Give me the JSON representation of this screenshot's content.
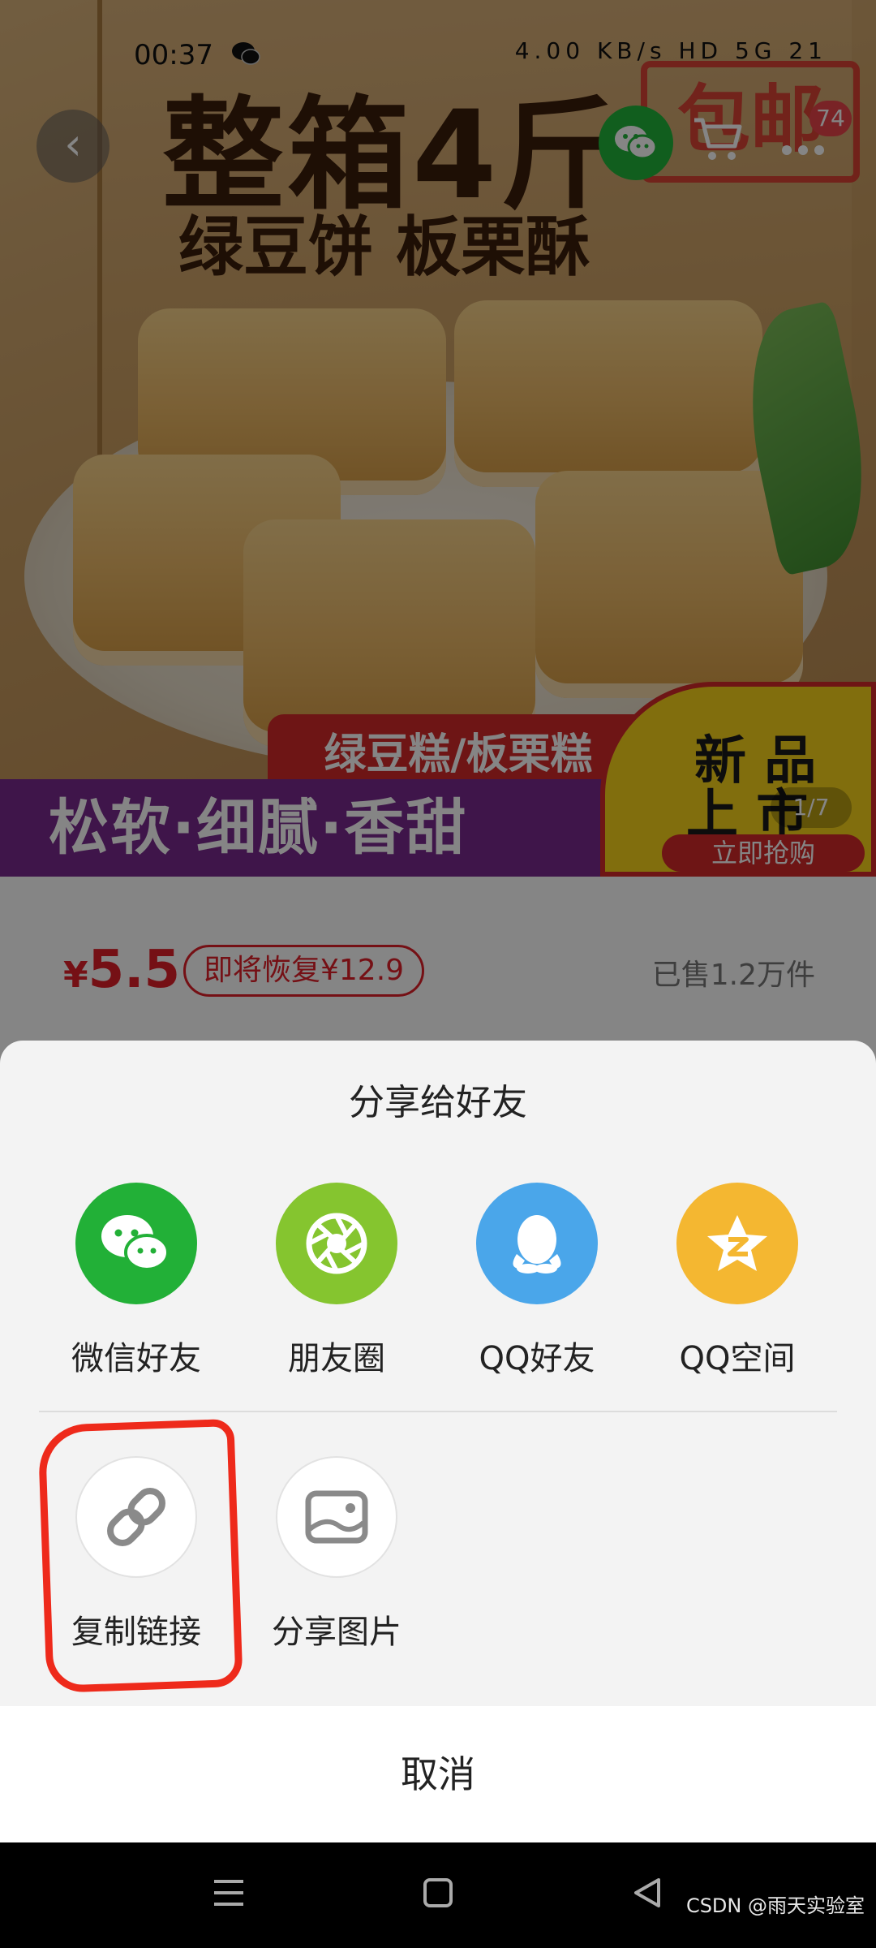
{
  "status_bar": {
    "time": "00:37",
    "right_text": "4.00 KB/s HD 5G 21"
  },
  "top_bar": {
    "back_glyph": "‹",
    "cart_count": "74"
  },
  "hero": {
    "title": "整箱4斤",
    "subtitle": "绿豆饼 板栗酥",
    "shipping_tag": "包邮",
    "red_ribbon": "绿豆糕/板栗糕",
    "purple_banner": "松软·细腻·香甜",
    "badge_line1": "新 品",
    "badge_line2": "上 市",
    "badge_button": "立即抢购",
    "pager": "1/7"
  },
  "price_row": {
    "currency": "¥",
    "price": "5.5",
    "restore_text": "即将恢复¥12.9",
    "sold_text": "已售1.2万件"
  },
  "share_sheet": {
    "title": "分享给好友",
    "row1": [
      {
        "label": "微信好友",
        "icon": "wechat-icon",
        "color": "#22b037"
      },
      {
        "label": "朋友圈",
        "icon": "moments-icon",
        "color": "#85c52f"
      },
      {
        "label": "QQ好友",
        "icon": "qq-icon",
        "color": "#4aa6ea"
      },
      {
        "label": "QQ空间",
        "icon": "qzone-icon",
        "color": "#f4b731"
      }
    ],
    "row2": [
      {
        "label": "复制链接",
        "icon": "link-icon"
      },
      {
        "label": "分享图片",
        "icon": "image-icon"
      }
    ],
    "cancel_label": "取消"
  },
  "highlight_color": "#ee2a1b",
  "watermark": "CSDN @雨天实验室"
}
